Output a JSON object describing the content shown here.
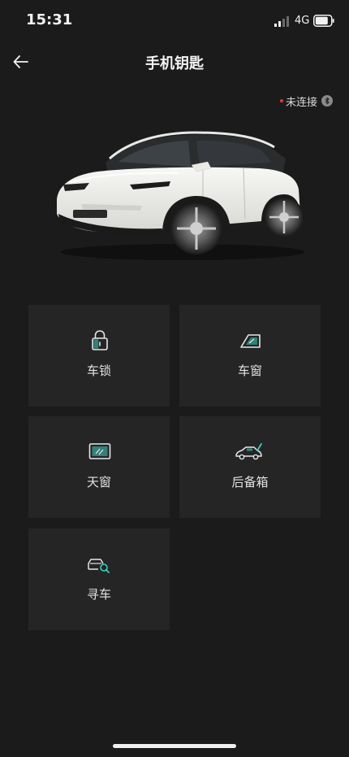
{
  "status_bar": {
    "time": "15:31",
    "network": "4G"
  },
  "header": {
    "title": "手机钥匙"
  },
  "connection": {
    "status": "未连接",
    "dot_color": "#e03a3a"
  },
  "tiles": [
    {
      "label": "车锁",
      "icon": "lock-icon"
    },
    {
      "label": "车窗",
      "icon": "car-window-icon"
    },
    {
      "label": "天窗",
      "icon": "sunroof-icon"
    },
    {
      "label": "后备箱",
      "icon": "trunk-icon"
    },
    {
      "label": "寻车",
      "icon": "find-car-icon"
    }
  ],
  "colors": {
    "background": "#1b1b1b",
    "tile": "#252525",
    "accent": "#3ccfc0"
  }
}
